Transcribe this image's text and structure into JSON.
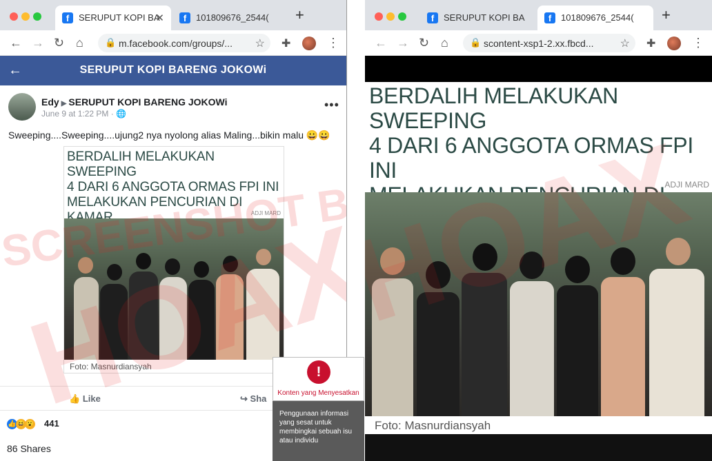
{
  "left_window": {
    "tabs": [
      {
        "label": "SERUPUT KOPI BA",
        "active": true
      },
      {
        "label": "101809676_2544(",
        "active": false
      }
    ],
    "address": "m.facebook.com/groups/...",
    "page_header_title": "SERUPUT KOPI BARENG JOKOWi",
    "post": {
      "author": "Edy",
      "group": "SERUPUT KOPI BARENG JOKOWi",
      "date": "June 9 at 1:22 PM · ",
      "text": "Sweeping....Sweeping....ujung2 nya nyolong alias Maling...bikin malu 😀😀",
      "image": {
        "headline": "BERDALIH MELAKUKAN SWEEPING\n4 DARI 6 ANGGOTA ORMAS FPI INI\nMELAKUKAN PENCURIAN DI KAMAR\nHOTEL DI JAKARTA.",
        "watermark": "ADJI MARD",
        "credit": "Foto: Masnurdiansyah"
      },
      "like_label": "Like",
      "share_label": "Sha",
      "reaction_count": "441",
      "shares_label": "86 Shares"
    }
  },
  "right_window": {
    "tabs": [
      {
        "label": "SERUPUT KOPI BA",
        "active": false
      },
      {
        "label": "101809676_2544(",
        "active": true
      }
    ],
    "address": "scontent-xsp1-2.xx.fbcd...",
    "image": {
      "headline": "BERDALIH MELAKUKAN SWEEPING\n4 DARI 6 ANGGOTA ORMAS FPI INI\nMELAKUKAN PENCURIAN DI KAMAR\nHOTEL DI JAKARTA.",
      "watermark": "ADJI MARD",
      "credit": "Foto: Masnurdiansyah"
    }
  },
  "overlay": {
    "stamp_text": "SCREENSHOT BY",
    "stamp_big": "HOAX",
    "label_title": "Konten yang Menyesatkan",
    "label_desc": "Penggunaan informasi yang sesat untuk membingkai sebuah isu atau individu"
  },
  "colors": {
    "facebook_blue": "#3b5998",
    "chrome_tab_bg": "#dee1e6",
    "stamp_red": "#e61e1e",
    "label_red": "#c8102e"
  }
}
